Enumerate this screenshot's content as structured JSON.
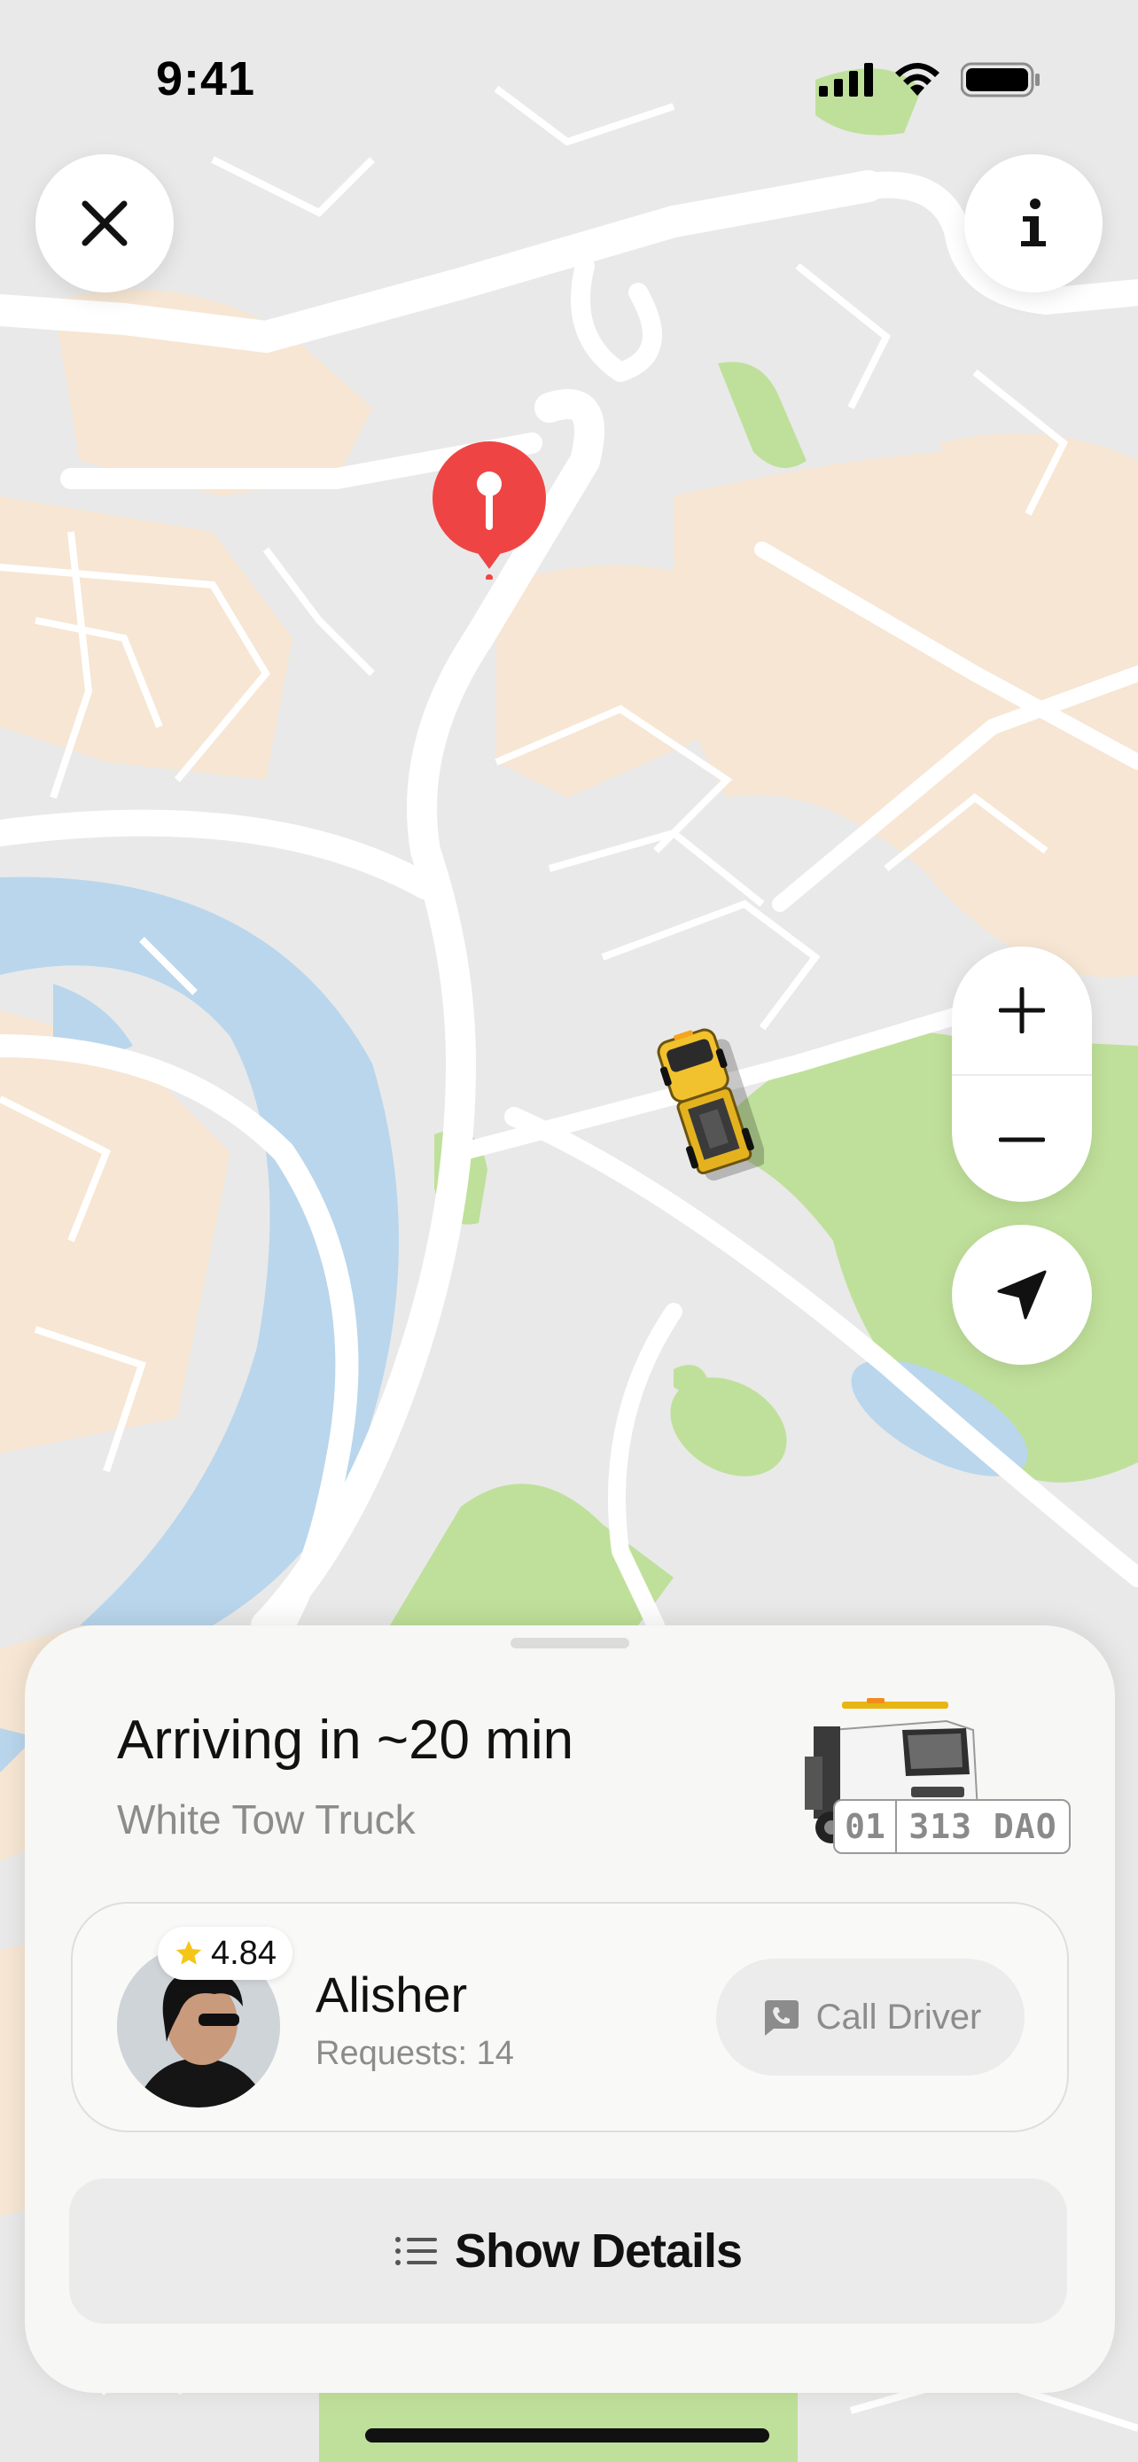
{
  "status_bar": {
    "time": "9:41",
    "icons": [
      "signal-icon",
      "wifi-icon",
      "battery-icon"
    ]
  },
  "map_controls": {
    "close_icon": "close-icon",
    "info_icon": "info-icon",
    "zoom_in_icon": "plus-icon",
    "zoom_out_icon": "minus-icon",
    "locate_icon": "location-arrow-icon"
  },
  "map": {
    "destination_marker": "pin-icon",
    "vehicle_marker": "tow-truck-icon",
    "colors": {
      "land": "#e9e9e9",
      "road": "#ffffff",
      "water": "#b9d6ec",
      "park": "#bfe09a",
      "urban": "#f6e6d3",
      "pin": "#ef4444"
    }
  },
  "trip": {
    "eta": "Arriving in ~20 min",
    "vehicle": "White Tow Truck",
    "plate_region": "01",
    "plate_number": "313 DAO"
  },
  "driver": {
    "rating": "4.84",
    "name": "Alisher",
    "requests": "Requests: 14",
    "call_label": "Call Driver"
  },
  "actions": {
    "details_label": "Show Details"
  },
  "colors": {
    "accent_red": "#ef4444",
    "star": "#f5c518",
    "muted_text": "#8c8c8c"
  }
}
